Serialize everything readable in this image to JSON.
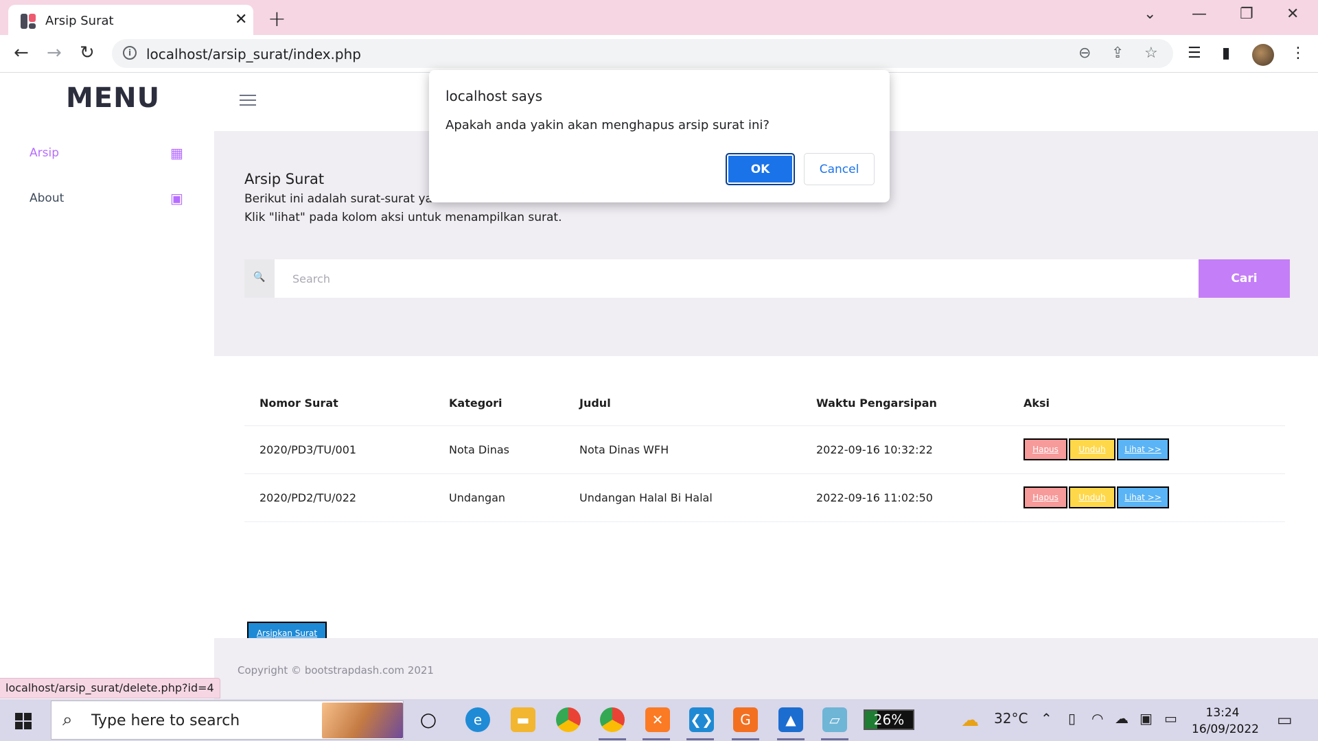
{
  "browser": {
    "tab_title": "Arsip Surat",
    "tab_close": "✕",
    "new_tab": "+",
    "url": "localhost/arsip_surat/index.php",
    "status_url": "localhost/arsip_surat/delete.php?id=4",
    "window_controls": {
      "tabs_menu": "⌄",
      "minimize": "—",
      "restore": "❐",
      "close": "✕"
    },
    "nav": {
      "back": "←",
      "forward": "→",
      "reload": "↻"
    },
    "omnibox_icons": {
      "zoom": "⊖",
      "share": "⇪",
      "bookmark": "☆"
    },
    "toolbar_icons": {
      "media": "☰",
      "side_panel": "▮",
      "more": "⋮"
    }
  },
  "sidebar": {
    "brand": "MENU",
    "items": [
      {
        "label": "Arsip",
        "icon": "table-icon",
        "glyph": "▦",
        "active": true,
        "color": "#b66dff"
      },
      {
        "label": "About",
        "icon": "contact-icon",
        "glyph": "▣",
        "active": false,
        "color": "#b66dff"
      }
    ]
  },
  "hero": {
    "title": "Arsip Surat",
    "line1": "Berikut ini adalah surat-surat yan",
    "line2": "Klik \"lihat\" pada kolom aksi untuk menampilkan surat.",
    "search_placeholder": "Search",
    "search_icon": "🔍",
    "search_button": "Cari"
  },
  "table": {
    "headers": [
      "Nomor Surat",
      "Kategori",
      "Judul",
      "Waktu Pengarsipan",
      "Aksi"
    ],
    "rows": [
      [
        "2020/PD3/TU/001",
        "Nota Dinas",
        "Nota Dinas WFH",
        "2022-09-16 10:32:22"
      ],
      [
        "2020/PD2/TU/022",
        "Undangan",
        "Undangan Halal Bi Halal",
        "2022-09-16 11:02:50"
      ]
    ],
    "actions": {
      "hapus": "Hapus",
      "unduh": "Unduh",
      "lihat": "Lihat >>"
    }
  },
  "archive_button": "Arsipkan Surat",
  "footer": "Copyright © bootstrapdash.com 2021",
  "dialog": {
    "title": "localhost says",
    "message": "Apakah anda yakin akan menghapus arsip surat ini?",
    "ok": "OK",
    "cancel": "Cancel"
  },
  "taskbar": {
    "search_placeholder": "Type here to search",
    "battery": "26%",
    "battery_fraction": 0.26,
    "temperature": "32°C",
    "time": "13:24",
    "date": "16/09/2022",
    "apps": [
      "cortana-icon",
      "edge-icon",
      "file-explorer-icon",
      "chrome-icon",
      "chrome-profile-icon",
      "xampp-icon",
      "vscode-icon",
      "pdf-icon",
      "photos-icon",
      "notepad-icon"
    ]
  },
  "colors": {
    "accent": "#b66dff",
    "button_primary": "#c47ef7",
    "tab_strip": "#f6d6e3",
    "hero_bg": "#f0edf3"
  }
}
